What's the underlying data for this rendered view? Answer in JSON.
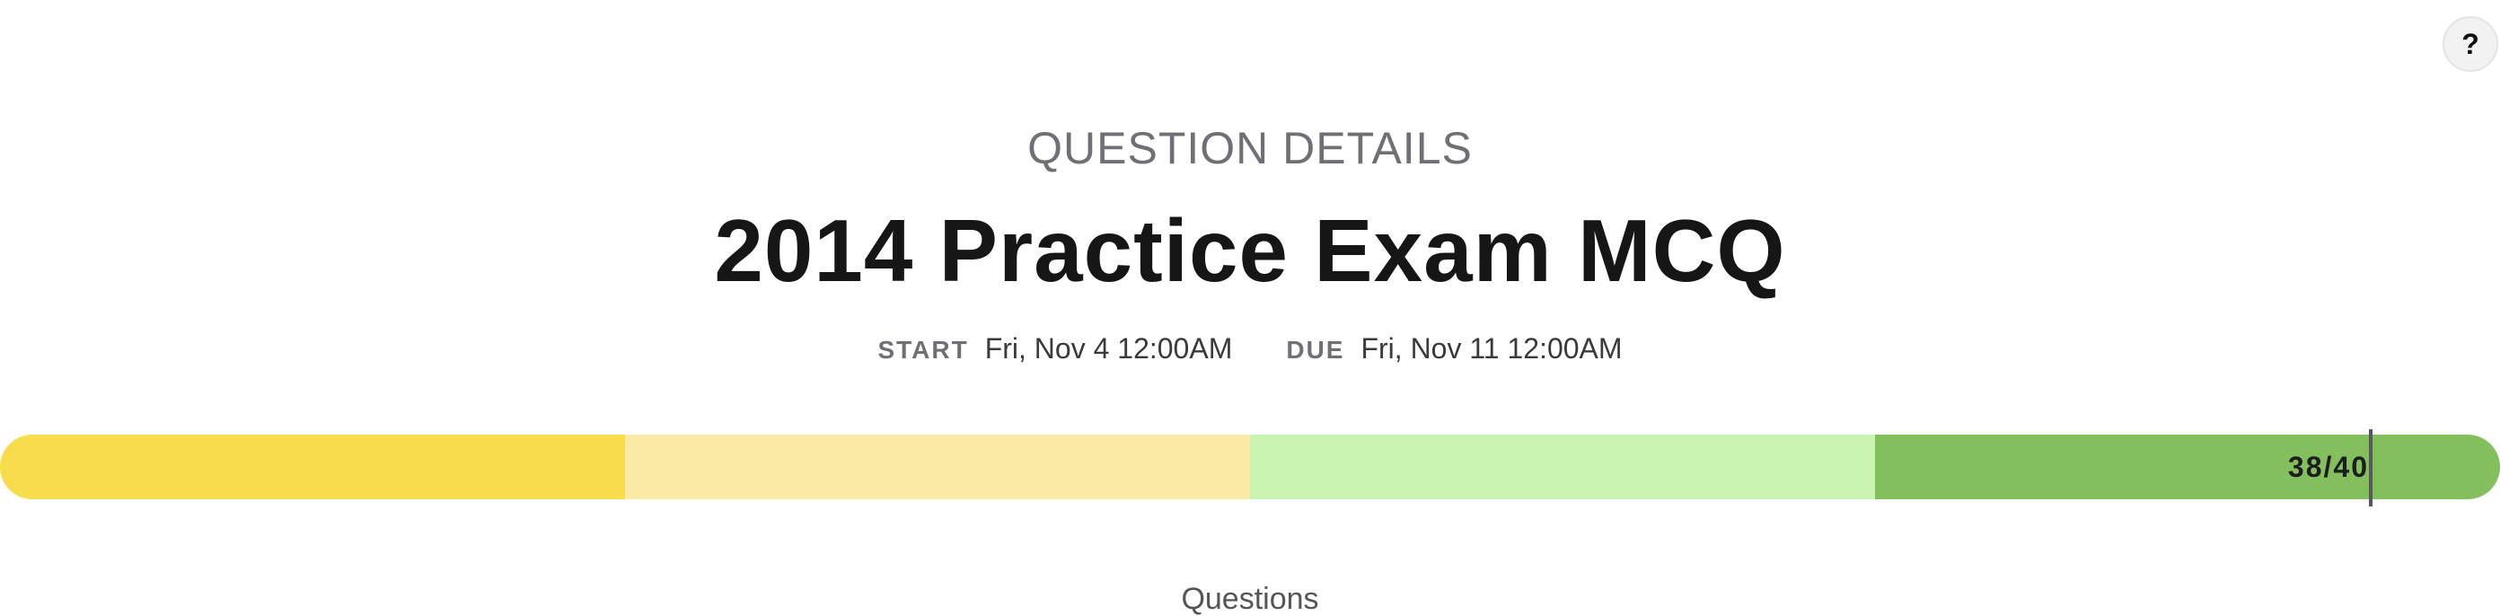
{
  "help": {
    "label": "?"
  },
  "header": {
    "eyebrow": "QUESTION DETAILS",
    "title": "2014 Practice Exam MCQ"
  },
  "dates": {
    "start_label": "START",
    "start_value": "Fri, Nov 4 12:00AM",
    "due_label": "DUE",
    "due_value": "Fri, Nov 11 12:00AM"
  },
  "score": {
    "label": "38/40",
    "earned": 38,
    "total": 40
  },
  "progress": {
    "segment_colors": [
      "#f8dc4c",
      "#faeaa6",
      "#c9f4b2",
      "#84bf5e"
    ]
  },
  "section": {
    "label": "Questions"
  }
}
